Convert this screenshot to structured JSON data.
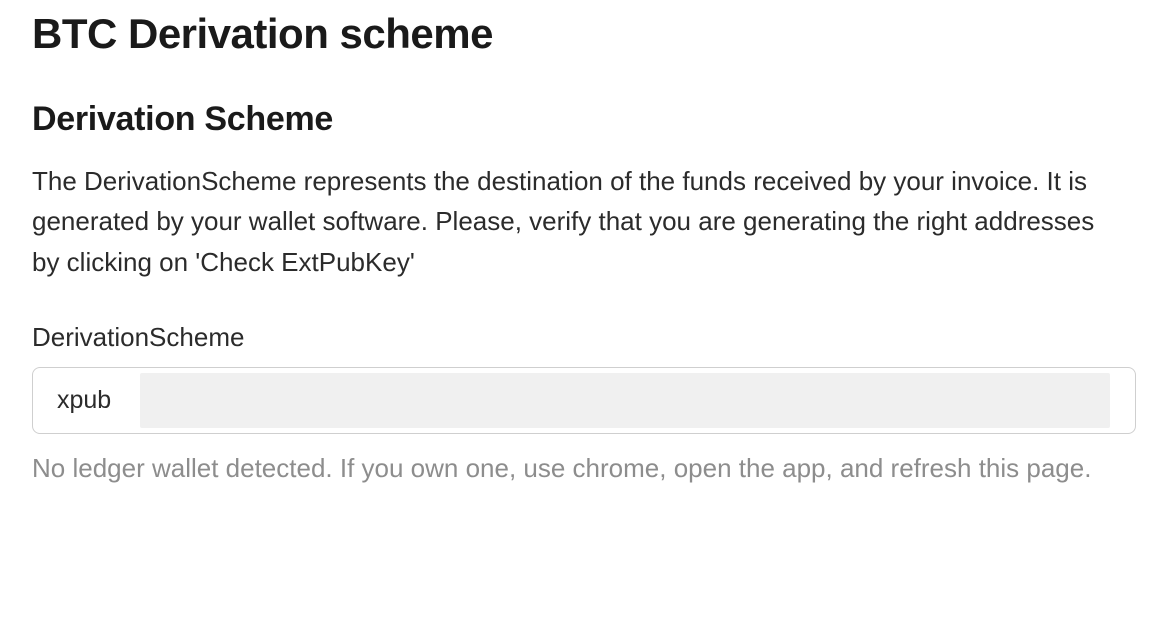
{
  "page": {
    "title": "BTC Derivation scheme"
  },
  "section": {
    "title": "Derivation Scheme",
    "description": "The DerivationScheme represents the destination of the funds received by your invoice. It is generated by your wallet software. Please, verify that you are generating the right addresses by clicking on 'Check ExtPubKey'"
  },
  "form": {
    "derivation_scheme": {
      "label": "DerivationScheme",
      "value": "xpub",
      "hint": "No ledger wallet detected. If you own one, use chrome, open the app, and refresh this page."
    }
  }
}
